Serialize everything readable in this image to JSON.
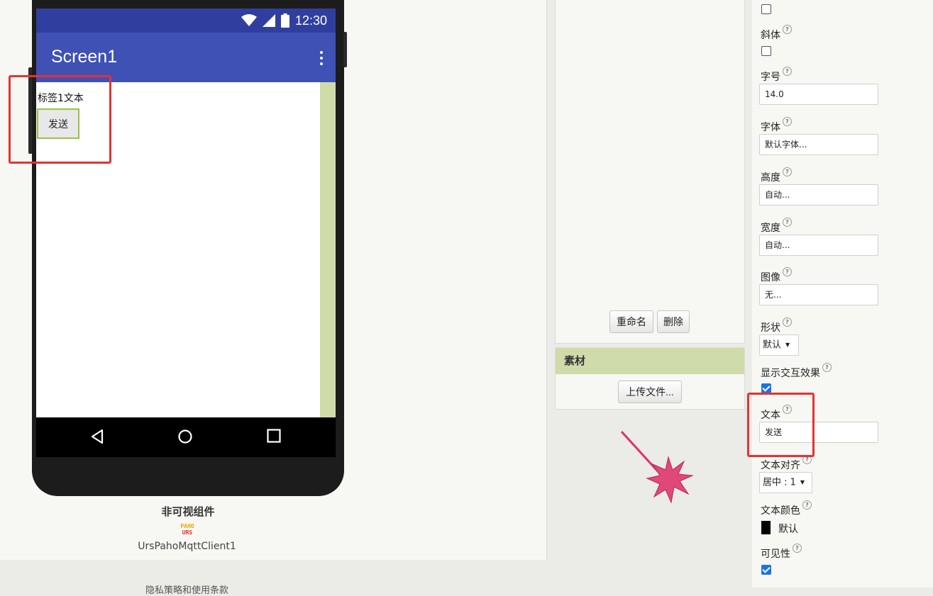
{
  "viewer": {
    "status_time": "12:30",
    "app_title": "Screen1",
    "label_text": "标签1文本",
    "button_text": "发送",
    "non_visible_title": "非可视组件",
    "paho_logo_top": "PAHO",
    "paho_logo_bottom": "URS",
    "non_visible_component": "UrsPahoMqttClient1"
  },
  "components": {
    "rename_button": "重命名",
    "delete_button": "删除"
  },
  "media": {
    "title": "素材",
    "upload_button": "上传文件..."
  },
  "properties": {
    "help_glyph": "?",
    "italic_label": "斜体",
    "font_size_label": "字号",
    "font_size_value": "14.0",
    "font_family_label": "字体",
    "font_family_value": "默认字体...",
    "height_label": "高度",
    "height_value": "自动...",
    "width_label": "宽度",
    "width_value": "自动...",
    "image_label": "图像",
    "image_value": "无...",
    "shape_label": "形状",
    "shape_value": "默认",
    "show_feedback_label": "显示交互效果",
    "show_feedback_checked": true,
    "text_label": "文本",
    "text_value": "发送",
    "text_align_label": "文本对齐",
    "text_align_value": "居中 : 1",
    "text_color_label": "文本颜色",
    "text_color_value": "默认",
    "text_color_swatch": "#000000",
    "visible_label": "可见性",
    "visible_checked": true
  },
  "footer": {
    "text": "隐私策略和使用条款"
  },
  "colors": {
    "appbar": "#3f51b5",
    "statusbar": "#303f9f",
    "panel_header": "#cfdba9",
    "highlight_box": "#e53232",
    "checkbox_on": "#1a73e8"
  }
}
